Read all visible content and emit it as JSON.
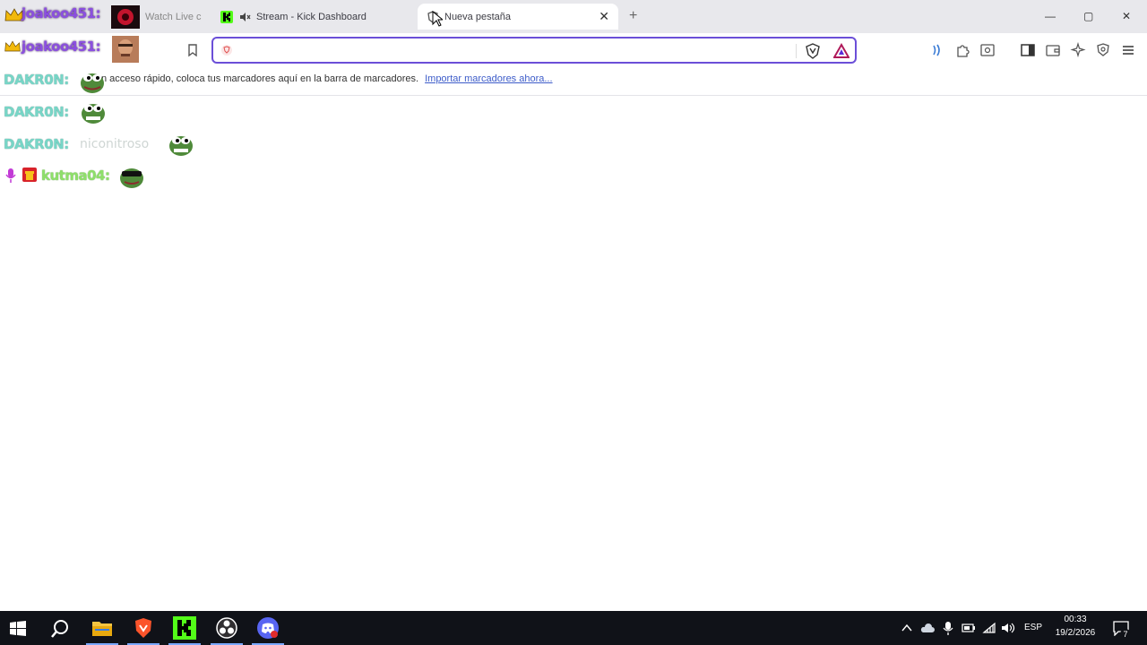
{
  "tabs": [
    {
      "label": "Watch Live c"
    },
    {
      "label": "Stream - Kick Dashboard"
    },
    {
      "label": "Nueva pestaña"
    }
  ],
  "window_controls": {
    "minimize": "—",
    "maximize": "▢",
    "close": "✕"
  },
  "omnibox": {
    "value": "",
    "placeholder": ""
  },
  "bookmarks_bar": {
    "message": "Para un acceso rápido, coloca tus marcadores aquí en la barra de marcadores.",
    "visible_message": "n acceso rápido, coloca tus marcadores aquí en la barra de marcadores.",
    "import_link": "Importar marcadores ahora..."
  },
  "chat": [
    {
      "user": "joakoo451:",
      "message": "",
      "emote": "face-photo"
    },
    {
      "user": "DAKR0N:",
      "message": "",
      "emote": "pepe"
    },
    {
      "user": "DAKR0N:",
      "message": "",
      "emote": "pepe"
    },
    {
      "user": "DAKR0N:",
      "message": "niconitroso",
      "emote": "pepe"
    },
    {
      "user": "kutma04:",
      "message": "",
      "emote": "pepe-sunglasses"
    }
  ],
  "taskbar": {
    "apps": [
      "windows-start",
      "search",
      "file-explorer",
      "brave",
      "kick",
      "obs",
      "discord"
    ],
    "tray": {
      "language": "ESP",
      "time": "00:33",
      "date": "19/2/2026",
      "notifications": "7"
    }
  },
  "colors": {
    "accent": "#6b4fd8",
    "kick_green": "#53fc18",
    "brave_orange": "#fb542b",
    "taskbar": "#101218"
  }
}
